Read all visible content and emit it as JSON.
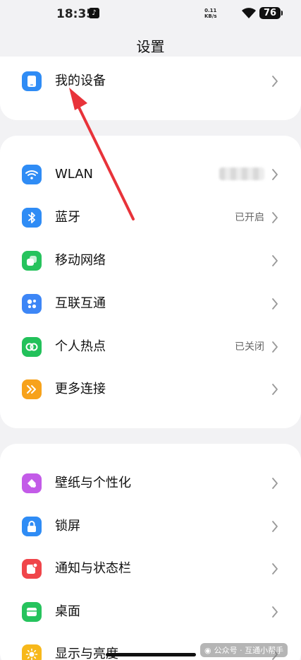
{
  "status_bar": {
    "time": "18:35",
    "net_speed_value": "0.11",
    "net_speed_unit": "KB/s",
    "battery": "76"
  },
  "page_title": "设置",
  "my_device": {
    "label": "我的设备"
  },
  "connectivity": [
    {
      "key": "wlan",
      "label": "WLAN",
      "value": "",
      "icon": "wifi-icon",
      "color": "#2f8cf5"
    },
    {
      "key": "bluetooth",
      "label": "蓝牙",
      "value": "已开启",
      "icon": "bluetooth-icon",
      "color": "#2f8cf5"
    },
    {
      "key": "mobile",
      "label": "移动网络",
      "value": "",
      "icon": "mobile-network-icon",
      "color": "#26c35d"
    },
    {
      "key": "interconnect",
      "label": "互联互通",
      "value": "",
      "icon": "interconnect-icon",
      "color": "#3d86f6"
    },
    {
      "key": "hotspot",
      "label": "个人热点",
      "value": "已关闭",
      "icon": "hotspot-icon",
      "color": "#22c15a"
    },
    {
      "key": "more",
      "label": "更多连接",
      "value": "",
      "icon": "more-connections-icon",
      "color": "#f7a21b"
    }
  ],
  "personalization": [
    {
      "key": "wallpaper",
      "label": "壁纸与个性化",
      "icon": "wallpaper-icon",
      "color": "#c35be8"
    },
    {
      "key": "lock",
      "label": "锁屏",
      "icon": "lock-icon",
      "color": "#2f8cf5"
    },
    {
      "key": "notify",
      "label": "通知与状态栏",
      "icon": "notification-icon",
      "color": "#f0454a"
    },
    {
      "key": "desktop",
      "label": "桌面",
      "icon": "desktop-icon",
      "color": "#26c35d"
    },
    {
      "key": "display",
      "label": "显示与亮度",
      "icon": "brightness-icon",
      "color": "#f7b81b"
    }
  ],
  "watermark": {
    "text": "公众号 · 互通小帮手"
  }
}
